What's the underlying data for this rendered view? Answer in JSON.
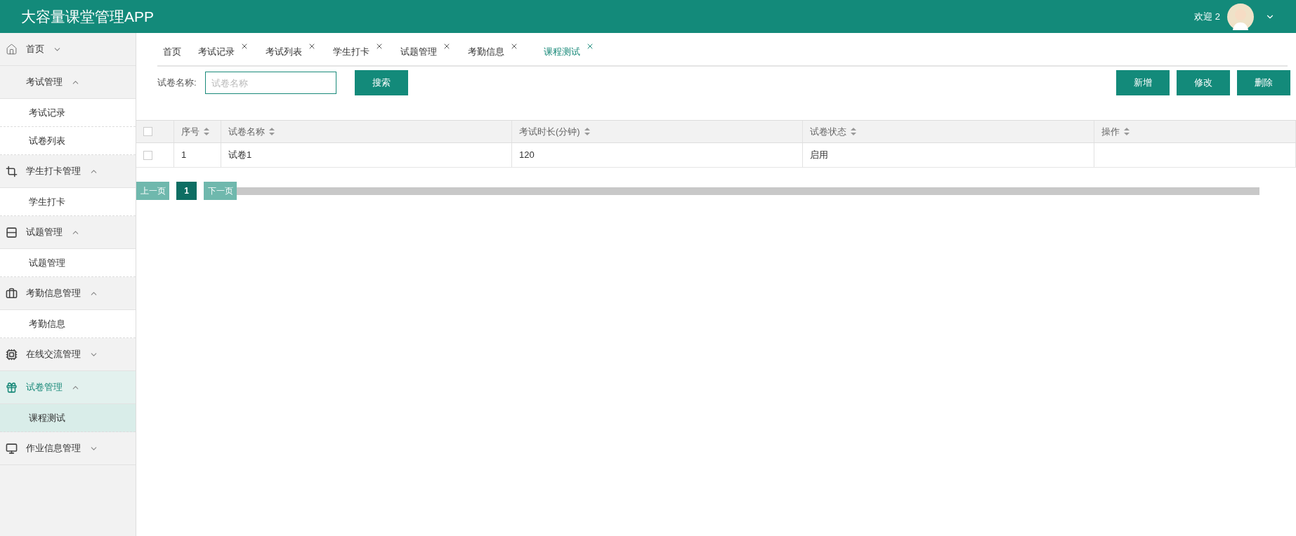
{
  "header": {
    "title": "大容量课堂管理APP",
    "welcome": "欢迎 2"
  },
  "sidebar": {
    "groups": [
      {
        "label": "首页",
        "expanded": false,
        "selected": false
      },
      {
        "label": "考试管理",
        "expanded": true,
        "selected": false,
        "children": [
          {
            "label": "考试记录",
            "selected": false
          },
          {
            "label": "试卷列表",
            "selected": false
          }
        ]
      },
      {
        "label": "学生打卡管理",
        "expanded": true,
        "selected": false,
        "children": [
          {
            "label": "学生打卡",
            "selected": false
          }
        ]
      },
      {
        "label": "试题管理",
        "expanded": true,
        "selected": false,
        "children": [
          {
            "label": "试题管理",
            "selected": false
          }
        ]
      },
      {
        "label": "考勤信息管理",
        "expanded": true,
        "selected": false,
        "children": [
          {
            "label": "考勤信息",
            "selected": false
          }
        ]
      },
      {
        "label": "在线交流管理",
        "expanded": false,
        "selected": false
      },
      {
        "label": "试卷管理",
        "expanded": true,
        "selected": true,
        "children": [
          {
            "label": "课程测试",
            "selected": true
          }
        ]
      },
      {
        "label": "作业信息管理",
        "expanded": false,
        "selected": false
      }
    ]
  },
  "tabs": [
    {
      "label": "首页",
      "closable": false,
      "selected": false
    },
    {
      "label": "考试记录",
      "closable": true,
      "selected": false
    },
    {
      "label": "考试列表",
      "closable": true,
      "selected": false
    },
    {
      "label": "学生打卡",
      "closable": true,
      "selected": false
    },
    {
      "label": "试题管理",
      "closable": true,
      "selected": false
    },
    {
      "label": "考勤信息",
      "closable": true,
      "selected": false
    },
    {
      "label": "课程测试",
      "closable": true,
      "selected": true
    }
  ],
  "search": {
    "label": "试卷名称:",
    "placeholder": "试卷名称",
    "button": "搜索"
  },
  "actions": [
    "新增",
    "修改",
    "删除"
  ],
  "table": {
    "all_checked": false,
    "columns": [
      "序号",
      "试卷名称",
      "考试时长(分钟)",
      "试卷状态",
      "操作"
    ],
    "rows": [
      {
        "checked": false,
        "cells": [
          "1",
          "试卷1",
          "120",
          "启用",
          ""
        ]
      }
    ]
  },
  "pagination": {
    "prev": "上一页",
    "pages": [
      {
        "label": "1",
        "selected": true
      }
    ],
    "next": "下一页"
  }
}
